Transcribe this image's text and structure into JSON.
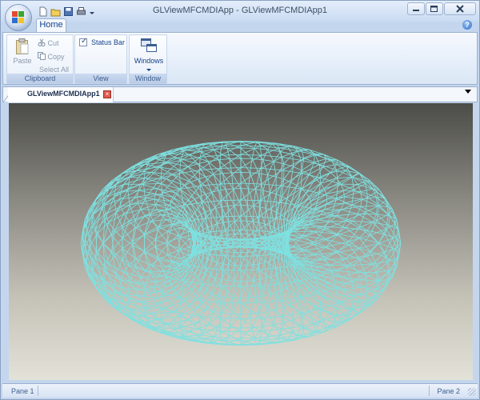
{
  "window": {
    "title": "GLViewMFCMDIApp - GLViewMFCMDIApp1"
  },
  "ribbon": {
    "tabs": [
      {
        "label": "Home"
      }
    ],
    "groups": {
      "clipboard": {
        "label": "Clipboard",
        "paste": "Paste",
        "cut": "Cut",
        "copy": "Copy",
        "select_all": "Select All"
      },
      "view": {
        "label": "View",
        "status_bar": "Status Bar",
        "status_bar_checked": true
      },
      "window": {
        "label": "Window",
        "windows": "Windows"
      }
    }
  },
  "document": {
    "tab_title": "GLViewMFCMDIApp1"
  },
  "statusbar": {
    "pane1": "Pane 1",
    "pane2": "Pane 2"
  },
  "colors": {
    "mesh": "#7ee0e0",
    "accent": "#15428b"
  }
}
